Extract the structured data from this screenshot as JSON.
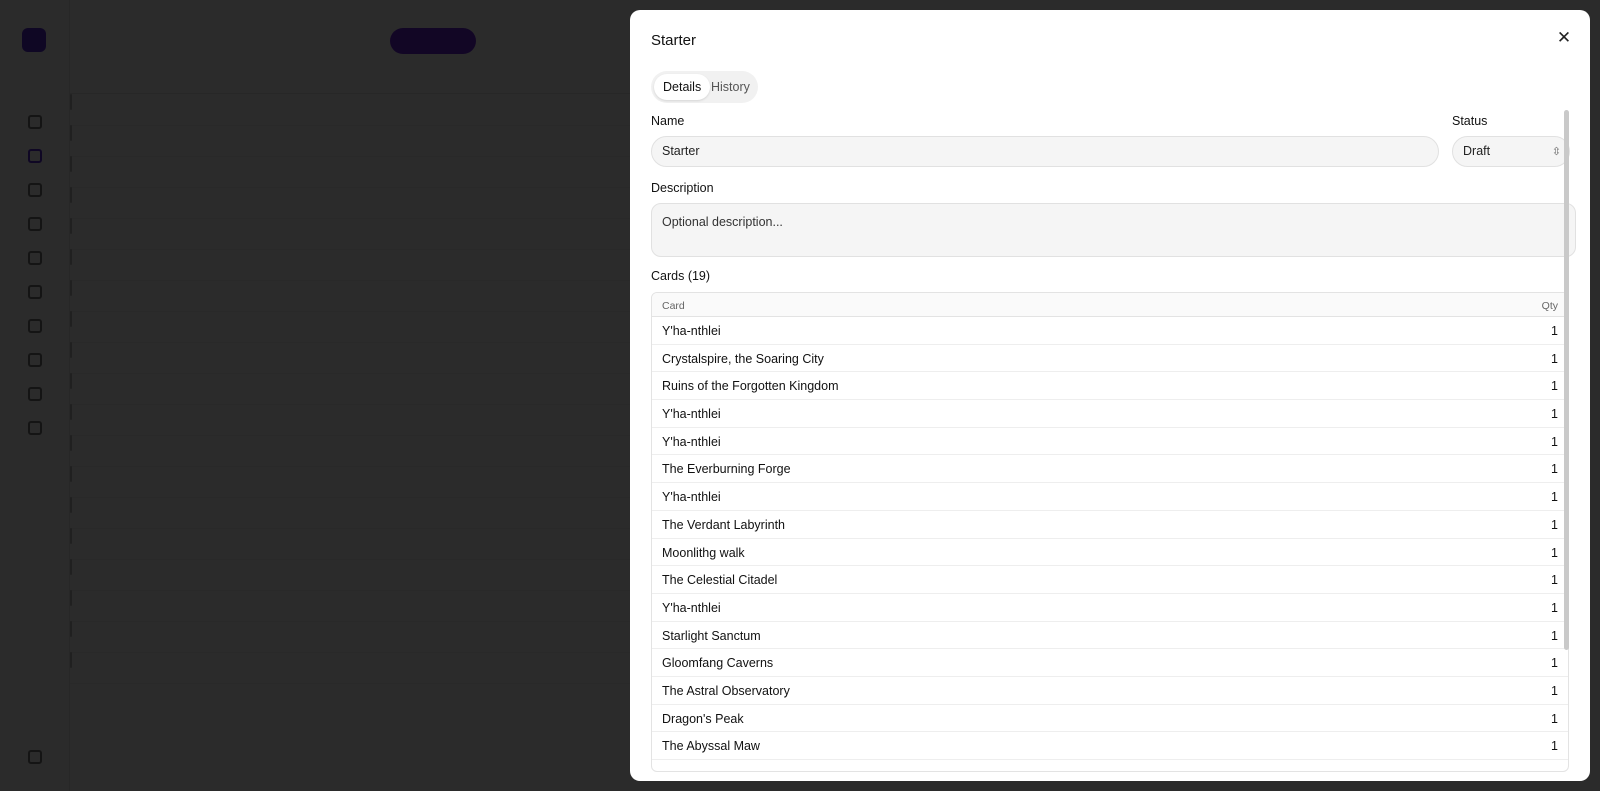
{
  "modal": {
    "title": "Starter",
    "close_icon": "close-icon",
    "tabs": [
      {
        "label": "Details",
        "active": true
      },
      {
        "label": "History",
        "active": false
      }
    ],
    "name": {
      "label": "Name",
      "value": "Starter"
    },
    "status": {
      "label": "Status",
      "value": "Draft",
      "icon": "chevron-up-down-icon"
    },
    "description": {
      "label": "Description",
      "placeholder": "Optional description..."
    },
    "cards": {
      "label": "Cards (19)",
      "columns": {
        "card": "Card",
        "qty": "Qty"
      },
      "rows": [
        {
          "card": "Y'ha-nthlei",
          "qty": "1"
        },
        {
          "card": "Crystalspire, the Soaring City",
          "qty": "1"
        },
        {
          "card": "Ruins of the Forgotten Kingdom",
          "qty": "1"
        },
        {
          "card": "Y'ha-nthlei",
          "qty": "1"
        },
        {
          "card": "Y'ha-nthlei",
          "qty": "1"
        },
        {
          "card": "The Everburning Forge",
          "qty": "1"
        },
        {
          "card": "Y'ha-nthlei",
          "qty": "1"
        },
        {
          "card": "The Verdant Labyrinth",
          "qty": "1"
        },
        {
          "card": "Moonlithg walk",
          "qty": "1"
        },
        {
          "card": "The Celestial Citadel",
          "qty": "1"
        },
        {
          "card": "Y'ha-nthlei",
          "qty": "1"
        },
        {
          "card": "Starlight Sanctum",
          "qty": "1"
        },
        {
          "card": "Gloomfang Caverns",
          "qty": "1"
        },
        {
          "card": "The Astral Observatory",
          "qty": "1"
        },
        {
          "card": "Dragon's Peak",
          "qty": "1"
        },
        {
          "card": "The Abyssal Maw",
          "qty": "1"
        }
      ]
    }
  },
  "colors": {
    "overlay": "#000000",
    "accent": "#5b2bd6"
  }
}
